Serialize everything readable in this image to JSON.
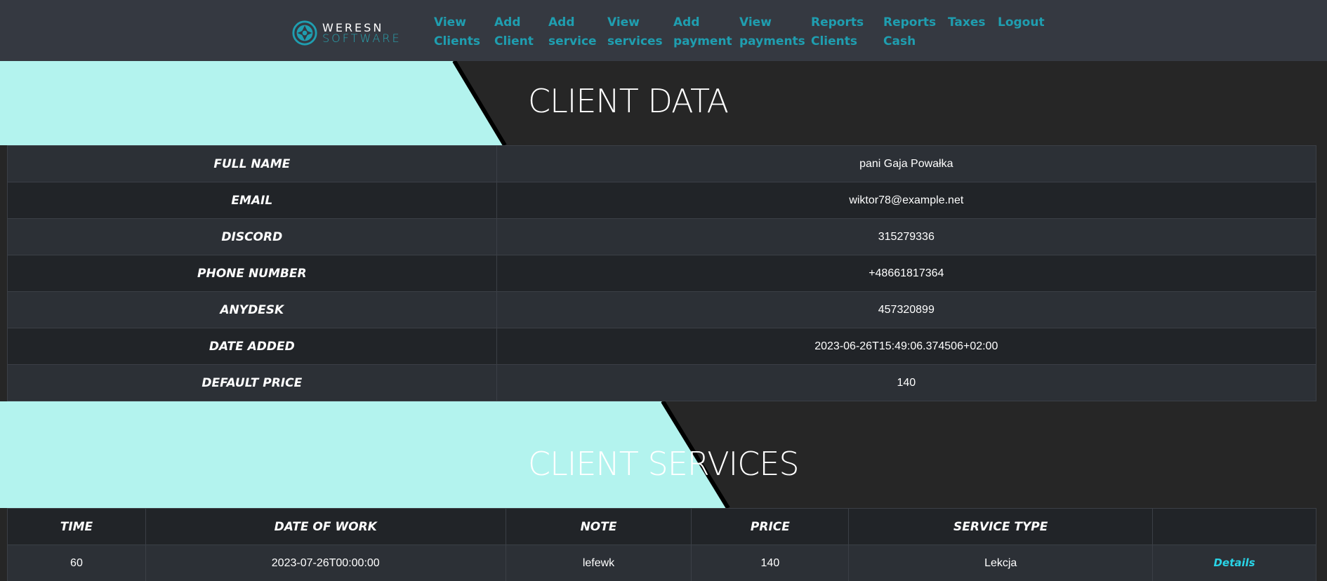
{
  "brand": {
    "line1": "WERESN",
    "line2": "SOFTWARE"
  },
  "nav": [
    {
      "label": "View\nClients"
    },
    {
      "label": "Add\nClient"
    },
    {
      "label": "Add\nservice"
    },
    {
      "label": "View\nservices"
    },
    {
      "label": "Add\npayment"
    },
    {
      "label": "View\npayments"
    },
    {
      "label": "Reports\nClients"
    },
    {
      "label": "Reports\nCash"
    },
    {
      "label": "Taxes"
    },
    {
      "label": "Logout"
    }
  ],
  "client_data": {
    "title": "CLIENT DATA",
    "rows": [
      {
        "label": "FULL NAME",
        "value": "pani Gaja Powałka"
      },
      {
        "label": "EMAIL",
        "value": "wiktor78@example.net"
      },
      {
        "label": "DISCORD",
        "value": "315279336"
      },
      {
        "label": "PHONE NUMBER",
        "value": "+48661817364"
      },
      {
        "label": "ANYDESK",
        "value": "457320899"
      },
      {
        "label": "DATE ADDED",
        "value": "2023-06-26T15:49:06.374506+02:00"
      },
      {
        "label": "DEFAULT PRICE",
        "value": "140"
      }
    ]
  },
  "client_services": {
    "title": "CLIENT SERVICES",
    "headers": [
      "TIME",
      "DATE OF WORK",
      "NOTE",
      "PRICE",
      "SERVICE TYPE",
      ""
    ],
    "rows": [
      {
        "time": "60",
        "date_of_work": "2023-07-26T00:00:00",
        "note": "lefewk",
        "price": "140",
        "service_type": "Lekcja",
        "action": "Details"
      }
    ]
  },
  "colors": {
    "accent_cyan": "#b3f3ee",
    "nav_link": "#1f9eb0",
    "details_link": "#29d3e6",
    "dark_bg": "#262626"
  }
}
